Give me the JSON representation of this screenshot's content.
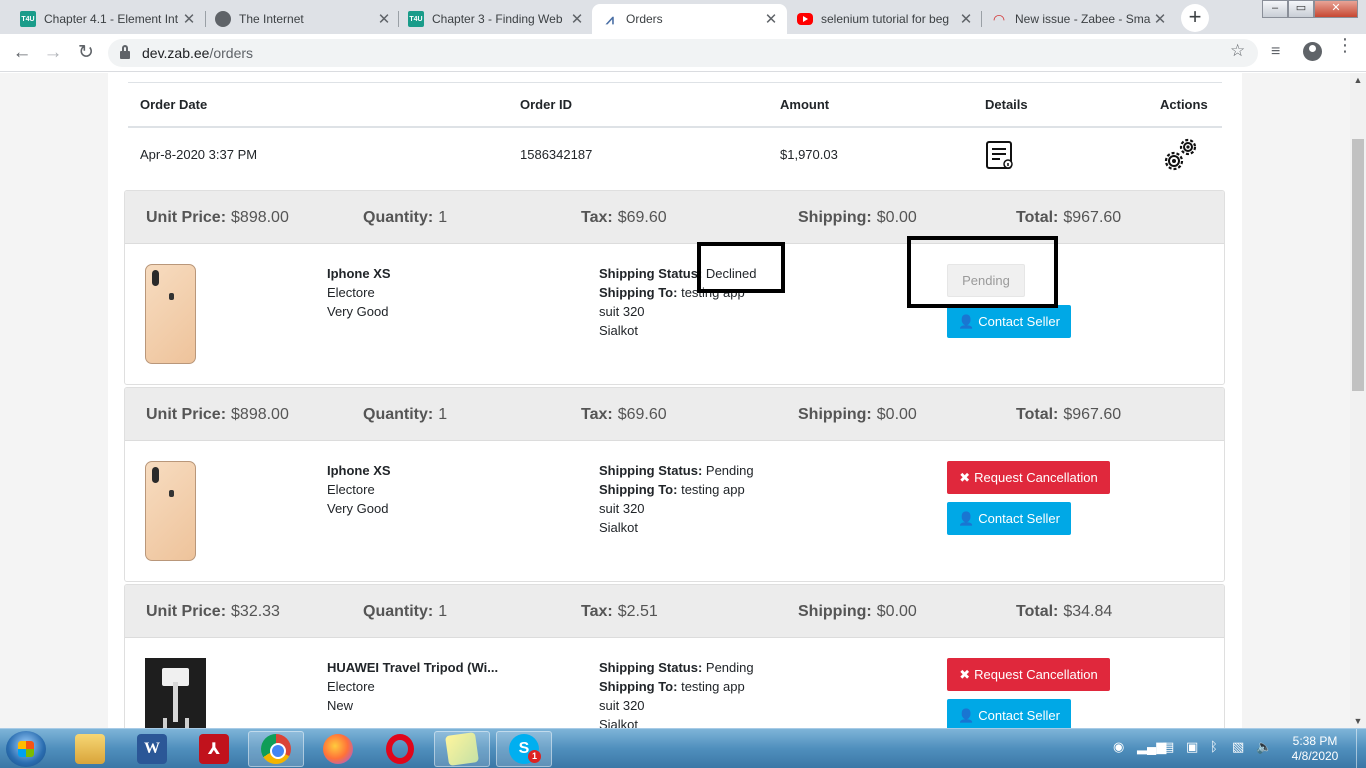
{
  "browser": {
    "tabs": [
      {
        "title": "Chapter 4.1 - Element Int",
        "favicon": "t4u-icon",
        "active": false
      },
      {
        "title": "The Internet",
        "favicon": "globe-icon",
        "active": false
      },
      {
        "title": "Chapter 3 - Finding Web",
        "favicon": "t4u-icon",
        "active": false
      },
      {
        "title": "Orders",
        "favicon": "orders-icon",
        "active": true
      },
      {
        "title": "selenium tutorial for beg",
        "favicon": "youtube-icon",
        "active": false
      },
      {
        "title": "New issue - Zabee - Sma",
        "favicon": "gauge-icon",
        "active": false
      }
    ],
    "favicon_text": {
      "t4u": "T4U"
    },
    "new_tab_glyph": "+",
    "tab_close_glyph": "✕",
    "url_host": "dev.zab.ee",
    "url_path": "/orders",
    "window_controls": {
      "minimize": "‒",
      "maximize": "▭",
      "close": "✕"
    }
  },
  "orders_table": {
    "headers": {
      "order_date": "Order Date",
      "order_id": "Order ID",
      "amount": "Amount",
      "details": "Details",
      "actions": "Actions"
    },
    "row": {
      "order_date": "Apr-8-2020 3:37 PM",
      "order_id": "1586342187",
      "amount": "$1,970.03",
      "details_icon": "receipt-icon",
      "actions_icon": "gears-icon"
    }
  },
  "labels": {
    "unit_price": "Unit Price:",
    "quantity": "Quantity:",
    "tax": "Tax:",
    "shipping": "Shipping:",
    "total": "Total:",
    "shipping_status": "Shipping Status:",
    "shipping_to": "Shipping To:"
  },
  "items": [
    {
      "unit_price": "$898.00",
      "quantity": "1",
      "tax": "$69.60",
      "shipping": "$0.00",
      "total": "$967.60",
      "name": "Iphone XS",
      "seller": "Electore",
      "condition": "Very Good",
      "shipping_status": "Declined",
      "shipping_to": "testing app",
      "address_line": "suit 320",
      "city": "Sialkot",
      "status_button": "Pending",
      "contact_button": "Contact Seller"
    },
    {
      "unit_price": "$898.00",
      "quantity": "1",
      "tax": "$69.60",
      "shipping": "$0.00",
      "total": "$967.60",
      "name": "Iphone XS",
      "seller": "Electore",
      "condition": "Very Good",
      "shipping_status": "Pending",
      "shipping_to": "testing app",
      "address_line": "suit 320",
      "city": "Sialkot",
      "cancel_button": "Request Cancellation",
      "contact_button": "Contact Seller"
    },
    {
      "unit_price": "$32.33",
      "quantity": "1",
      "tax": "$2.51",
      "shipping": "$0.00",
      "total": "$34.84",
      "name": "HUAWEI Travel Tripod (Wi...",
      "seller": "Electore",
      "condition": "New",
      "shipping_status": "Pending",
      "shipping_to": "testing app",
      "address_line": "suit 320",
      "city": "Sialkot",
      "cancel_button": "Request Cancellation",
      "contact_button": "Contact Seller"
    }
  ],
  "taskbar": {
    "time": "5:38 PM",
    "date": "4/8/2020",
    "skype_badge": "1",
    "word_letter": "W"
  },
  "colors": {
    "contact_button": "#00a8e6",
    "cancel_button": "#e0283c",
    "card_header": "#ececec"
  }
}
